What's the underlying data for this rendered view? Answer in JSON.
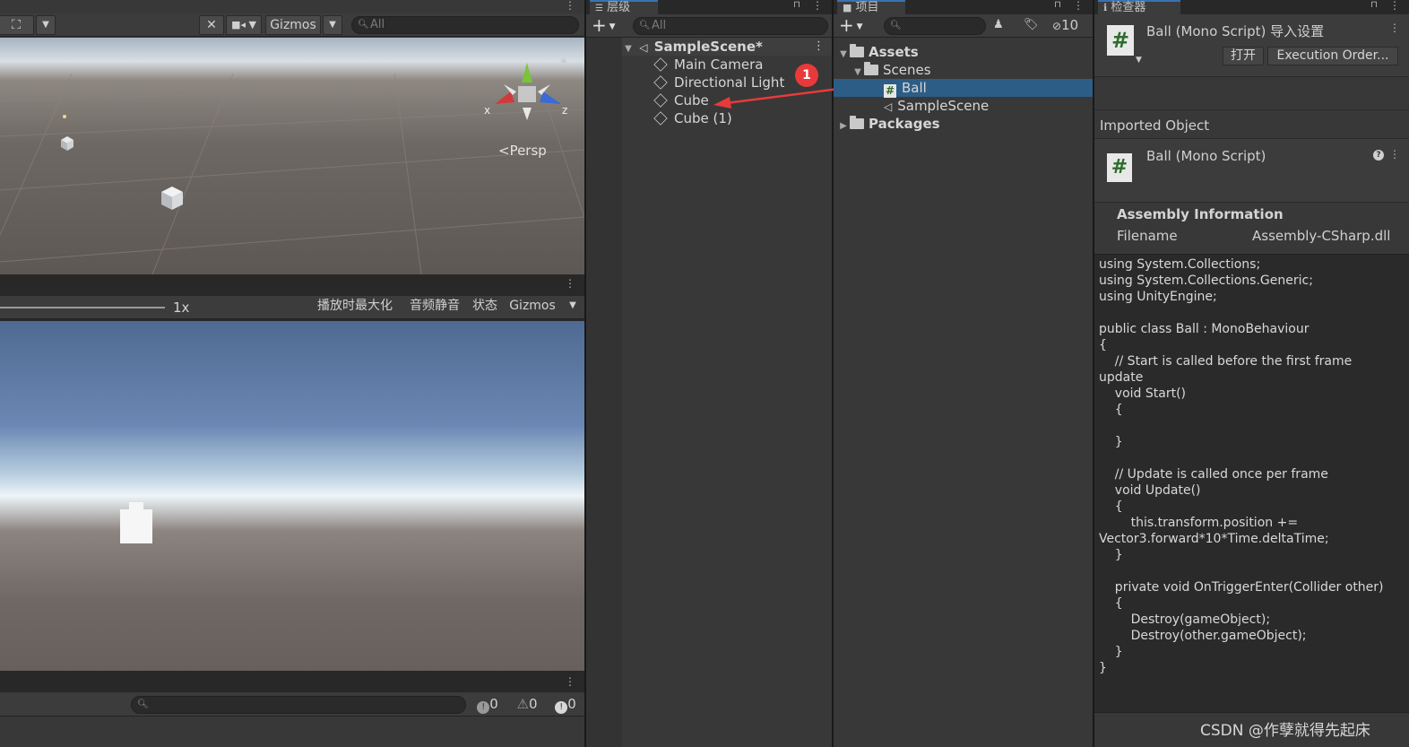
{
  "scene_view": {
    "toolbar": {
      "gizmos_label": "Gizmos",
      "search_placeholder": "All"
    },
    "persp_label": "<Persp",
    "axis_x": "x",
    "axis_z": "z"
  },
  "game_view": {
    "scale_label": "1x",
    "maximize_label": "播放时最大化",
    "mute_label": "音频静音",
    "stats_label": "状态",
    "gizmos_label": "Gizmos"
  },
  "console": {
    "info_count": "0",
    "warn_count": "0",
    "error_count": "0"
  },
  "hierarchy": {
    "tab_label": "层级",
    "search_placeholder": "All",
    "scene_name": "SampleScene*",
    "items": [
      {
        "label": "Main Camera"
      },
      {
        "label": "Directional Light"
      },
      {
        "label": "Cube"
      },
      {
        "label": "Cube (1)"
      }
    ],
    "annotation_number": "1",
    "annotation_color": "#e83a3a"
  },
  "project": {
    "tab_label": "项目",
    "hidden_count": "10",
    "tree": [
      {
        "label": "Assets"
      },
      {
        "label": "Scenes"
      },
      {
        "label": "Ball"
      },
      {
        "label": "SampleScene"
      },
      {
        "label": "Packages"
      }
    ],
    "selection_color": "#2c5d87"
  },
  "inspector": {
    "tab_label": "检查器",
    "header_title": "Ball (Mono Script) 导入设置",
    "open_button": "打开",
    "execution_order_button": "Execution Order...",
    "imported_object_label": "Imported Object",
    "object_title": "Ball (Mono Script)",
    "assembly_info_label": "Assembly Information",
    "filename_label": "Filename",
    "filename_value": "Assembly-CSharp.dll",
    "code_lines": [
      "using System.Collections;",
      "using System.Collections.Generic;",
      "using UnityEngine;",
      "",
      "public class Ball : MonoBehaviour",
      "{",
      "    // Start is called before the first frame",
      "update",
      "    void Start()",
      "    {",
      "",
      "    }",
      "",
      "    // Update is called once per frame",
      "    void Update()",
      "    {",
      "        this.transform.position +=",
      "Vector3.forward*10*Time.deltaTime;",
      "    }",
      "",
      "    private void OnTriggerEnter(Collider other)",
      "    {",
      "        Destroy(gameObject);",
      "        Destroy(other.gameObject);",
      "    }",
      "}"
    ]
  },
  "watermark": "CSDN @作孽就得先起床"
}
